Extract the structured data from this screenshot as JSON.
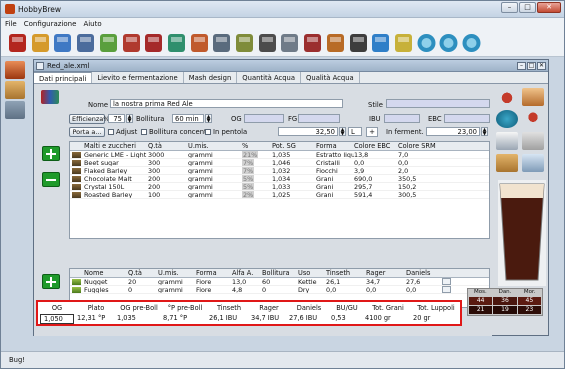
{
  "window": {
    "title": "HobbyBrew",
    "min": "–",
    "max": "□",
    "close": "✕"
  },
  "menu": [
    "File",
    "Configurazione",
    "Aiuto"
  ],
  "toolbar_icons": [
    "tools-icon",
    "new-document-icon",
    "folder-open-icon",
    "save-icon",
    "edit-icon",
    "calculator-icon",
    "hb-logo-icon",
    "clipboard-icon",
    "kettle-icon",
    "grid-icon",
    "fermenter-icon",
    "bottle-filler-icon",
    "gauge-icon",
    "gear-icon",
    "barrel-icon",
    "bottle-icon",
    "water-drop-icon",
    "hop-icon",
    "globe-icon-1",
    "globe-icon-2",
    "globe-icon-3"
  ],
  "document": {
    "title": "Red_ale.xml",
    "tabs": [
      "Dati principali",
      "Lievito e fermentazione",
      "Mash design",
      "Quantità Acqua",
      "Qualità Acqua"
    ],
    "active_tab": 0,
    "fields": {
      "nome_label": "Nome",
      "nome": "la nostra prima Red Ale",
      "stile_label": "Stile",
      "stile": "",
      "efficienza_label": "Efficienza%",
      "efficienza": "75",
      "bollitura_label": "Bollitura",
      "bollitura": "60 min",
      "og_label": "OG",
      "fg_label": "FG",
      "ibu_label": "IBU",
      "ebc_label": "EBC",
      "porta_label": "Porta a...",
      "adjust_label": "Adjust",
      "bollitura_concent_label": "Bollitura concent.",
      "in_pentola_label": "In pentola",
      "in_pentola": "32,50",
      "in_pentola_unit": "L",
      "in_ferment_label": "In ferment.",
      "in_ferment": "23,00",
      "in_ferment_unit": "L"
    },
    "malts": {
      "headers": [
        "Malti e zuccheri",
        "Q.tà",
        "U.mis.",
        "%",
        "Pot. SG",
        "Forma",
        "Colore EBC",
        "Colore SRM"
      ],
      "rows": [
        [
          "Generic LME - Light",
          "3000",
          "grammi",
          "21%",
          "1,035",
          "Estratto liqu...",
          "13,8",
          "7,0"
        ],
        [
          "Beet sugar",
          "300",
          "grammi",
          "7%",
          "1,046",
          "Cristalli",
          "0,0",
          "0,0"
        ],
        [
          "Flaked Barley",
          "300",
          "grammi",
          "7%",
          "1,032",
          "Fiocchi",
          "3,9",
          "2,0"
        ],
        [
          "Chocolate Malt",
          "200",
          "grammi",
          "5%",
          "1,034",
          "Grani",
          "690,0",
          "350,5"
        ],
        [
          "Crystal 150L",
          "200",
          "grammi",
          "5%",
          "1,033",
          "Grani",
          "295,7",
          "150,2"
        ],
        [
          "Roasted Barley",
          "100",
          "grammi",
          "2%",
          "1,025",
          "Grani",
          "591,4",
          "300,5"
        ]
      ]
    },
    "hops": {
      "headers": [
        "Nome",
        "Q.tà",
        "U.mis.",
        "Forma",
        "Alfa A.",
        "Bollitura",
        "Uso",
        "Tinseth",
        "Rager",
        "Daniels"
      ],
      "rows": [
        [
          "Nugget",
          "20",
          "grammi",
          "Fiore",
          "13,0",
          "60",
          "Kettle",
          "26,1",
          "34,7",
          "27,6"
        ],
        [
          "Fuggles",
          "0",
          "grammi",
          "Fiore",
          "4,8",
          "0",
          "Dry",
          "0,0",
          "0,0",
          "0,0"
        ]
      ]
    },
    "summary": {
      "headers": [
        "OG",
        "Plato",
        "OG pre-Boll",
        "°P pre-Boll",
        "Tinseth",
        "Rager",
        "Daniels",
        "BU/GU",
        "Tot. Grani",
        "Tot. Luppoli"
      ],
      "values": [
        "1,050",
        "12,31 °P",
        "1,035",
        "8,71 °P",
        "26,1 IBU",
        "34,7 IBU",
        "27,6 IBU",
        "0,53",
        "4100 gr",
        "20 gr"
      ]
    },
    "colors": {
      "labels": [
        "Mos.",
        "Dan.",
        "Mor."
      ],
      "values": [
        "44",
        "36",
        "45",
        "21",
        "19",
        "23"
      ],
      "cells": [
        "#5a1a10",
        "#4a160e",
        "#5c1b11",
        "#2b0c07",
        "#250a06",
        "#2e0d08"
      ]
    }
  },
  "status": "Bug!"
}
